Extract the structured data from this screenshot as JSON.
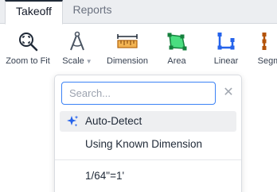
{
  "tabs": [
    {
      "label": "Takeoff",
      "active": true
    },
    {
      "label": "Reports",
      "active": false
    }
  ],
  "toolbar": {
    "tools": [
      {
        "label": "Zoom to Fit",
        "icon": "zoom-to-fit-icon"
      },
      {
        "label": "Scale",
        "icon": "compass-icon",
        "has_menu": true
      },
      {
        "label": "Dimension",
        "icon": "ruler-dimension-icon"
      },
      {
        "label": "Area",
        "icon": "area-polygon-icon"
      },
      {
        "label": "Linear",
        "icon": "linear-icon"
      },
      {
        "label": "Segm",
        "icon": "segment-icon"
      }
    ],
    "caret": "▼"
  },
  "scale_menu": {
    "search_placeholder": "Search...",
    "clear_symbol": "✕",
    "items": [
      {
        "label": "Auto-Detect",
        "icon": "sparkle-icon",
        "highlighted": true
      },
      {
        "label": "Using Known Dimension"
      },
      {
        "label": "1/64\"=1'"
      }
    ]
  },
  "colors": {
    "accent_blue": "#3b82f6",
    "icon_blue": "#2563eb",
    "area_green": "#22c55e",
    "dimension_orange": "#c2640a"
  }
}
